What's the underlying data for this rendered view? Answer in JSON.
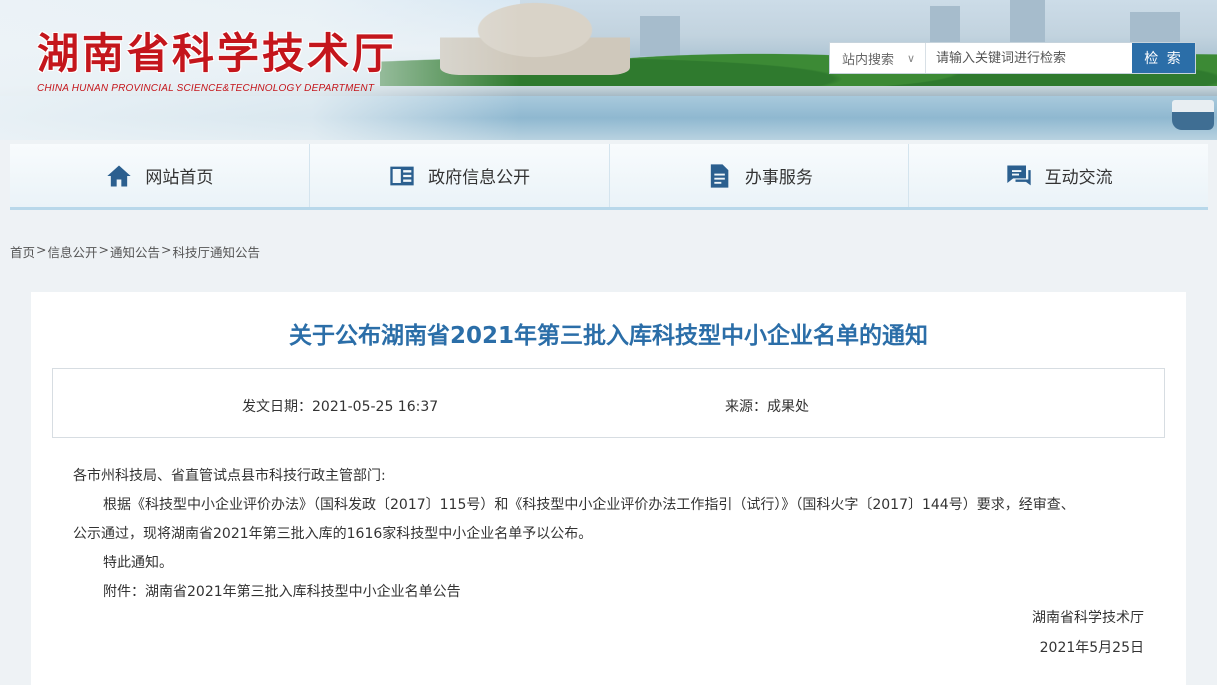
{
  "header": {
    "logo_cn": "湖南省科学技术厅",
    "logo_en": "CHINA HUNAN PROVINCIAL SCIENCE&TECHNOLOGY DEPARTMENT",
    "search": {
      "scope_label": "站内搜索",
      "scope_icon": "chevron-down-icon",
      "placeholder": "请输入关键词进行检索",
      "button_label": "检 索"
    }
  },
  "nav": {
    "items": [
      {
        "label": "网站首页",
        "icon": "home-icon"
      },
      {
        "label": "政府信息公开",
        "icon": "book-icon"
      },
      {
        "label": "办事服务",
        "icon": "document-icon"
      },
      {
        "label": "互动交流",
        "icon": "chat-icon"
      }
    ]
  },
  "breadcrumb": [
    "首页",
    "信息公开",
    "通知公告",
    "科技厅通知公告"
  ],
  "article": {
    "title": "关于公布湖南省2021年第三批入库科技型中小企业名单的通知",
    "date_label": "发文日期：2021-05-25 16:37",
    "source_label": "来源：成果处",
    "salutation": "各市州科技局、省直管试点县市科技行政主管部门:",
    "paragraph1_line1": "根据《科技型中小企业评价办法》（国科发政〔2017〕115号）和《科技型中小企业评价办法工作指引（试行）》（国科火字〔2017〕144号）要求，经审查、",
    "paragraph1_line2": "公示通过，现将湖南省2021年第三批入库的1616家科技型中小企业名单予以公布。",
    "closing": "特此通知。",
    "attachment": "附件：湖南省2021年第三批入库科技型中小企业名单公告",
    "signer": "湖南省科学技术厅",
    "sign_date": "2021年5月25日"
  }
}
